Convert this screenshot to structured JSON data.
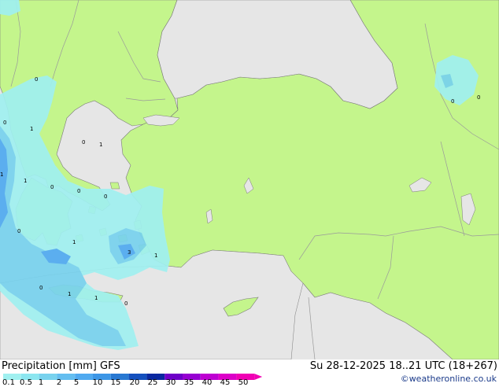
{
  "map": {
    "colors": {
      "sea": "#e6e6e6",
      "land": "#c4f58c",
      "border": "#9a9a9a",
      "coast": "#7a7a7a"
    },
    "precip_labels": [
      "1",
      "0",
      "0",
      "1",
      "1",
      "0",
      "0",
      "0",
      "1",
      "0",
      "3",
      "1",
      "1",
      "0",
      "1",
      "1",
      "0",
      "0",
      "0",
      "0"
    ]
  },
  "footer": {
    "title": "Precipitation [mm]  GFS",
    "validity": "Su 28-12-2025 18..21 UTC (18+267)",
    "credit": "©weatheronline.co.uk"
  },
  "legend": {
    "ticks": [
      "0.1",
      "0.5",
      "1",
      "2",
      "5",
      "10",
      "15",
      "20",
      "25",
      "30",
      "35",
      "40",
      "45",
      "50"
    ],
    "colors": [
      "#a0f0f0",
      "#8ce6f0",
      "#78d2ee",
      "#64bef0",
      "#50aaf0",
      "#3c96e6",
      "#2878d2",
      "#1450be",
      "#0a28a0",
      "#6e00c8",
      "#9600d2",
      "#be00d2",
      "#dc00c8",
      "#f000b4"
    ]
  }
}
